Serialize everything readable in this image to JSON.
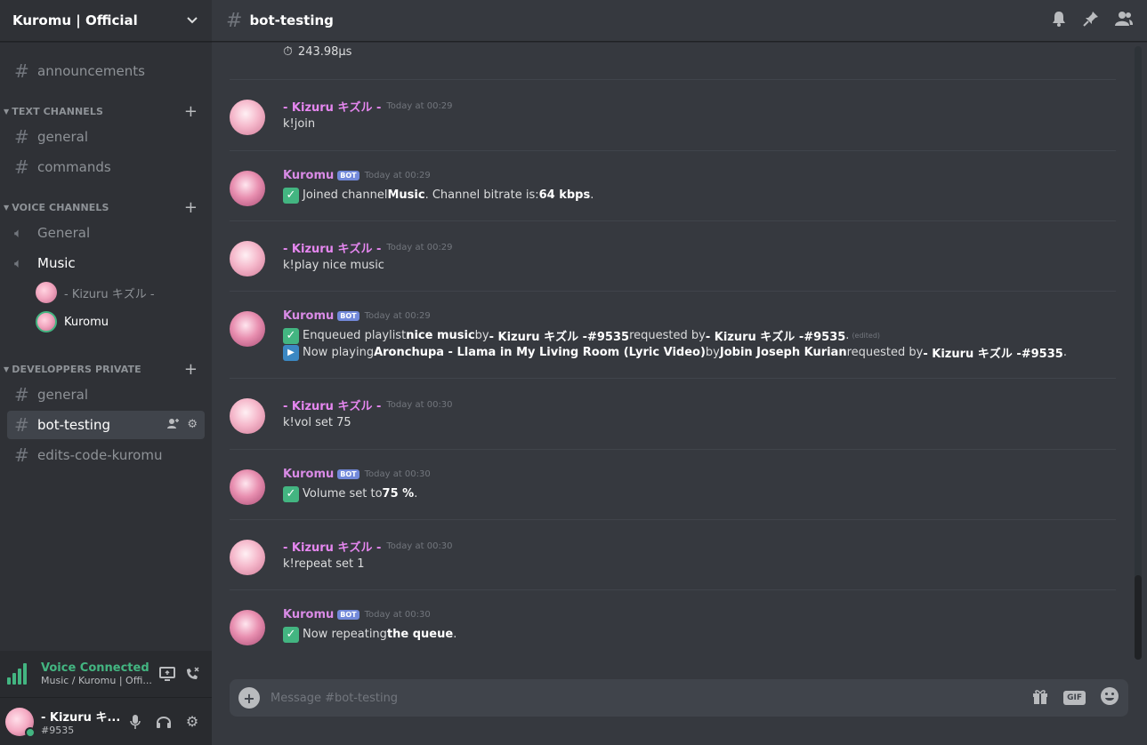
{
  "server": {
    "name": "Kuromu | Official"
  },
  "sidebar": {
    "top_channel": "announcements",
    "categories": [
      {
        "name": "TEXT CHANNELS"
      },
      {
        "name": "VOICE CHANNELS"
      },
      {
        "name": "DEVELOPPERS PRIVATE"
      }
    ],
    "text_channels": [
      "general",
      "commands"
    ],
    "voice_channels": [
      "General",
      "Music"
    ],
    "voice_users": [
      "- Kizuru キズル -",
      "Kuromu"
    ],
    "dev_channels": [
      "general",
      "bot-testing",
      "edits-code-kuromu"
    ]
  },
  "voice_panel": {
    "title": "Voice Connected",
    "subtitle": "Music / Kuromu | Offi..."
  },
  "user_panel": {
    "name": "- Kizuru キ...",
    "tag": "#9535"
  },
  "channel": {
    "name": "bot-testing"
  },
  "messages": {
    "first": "243.98µs",
    "m1": {
      "author": "- Kizuru キズル -",
      "time": "Today at 00:29",
      "text": "k!join"
    },
    "m2": {
      "author": "Kuromu",
      "badge": "BOT",
      "time": "Today at 00:29",
      "t1": "Joined channel ",
      "b1": "Music",
      "t2": ". Channel bitrate is: ",
      "b2": "64 kbps",
      "t3": "."
    },
    "m3": {
      "author": "- Kizuru キズル -",
      "time": "Today at 00:29",
      "text": "k!play nice music"
    },
    "m4": {
      "author": "Kuromu",
      "badge": "BOT",
      "time": "Today at 00:29",
      "a1": "Enqueued playlist ",
      "ab1": "nice music",
      "a2": " by ",
      "ab2": "- Kizuru キズル -#9535",
      "a3": " requested by ",
      "ab3": "- Kizuru キズル -#9535",
      "a4": ".",
      "edited": "(edited)",
      "p1": "Now playing ",
      "pb1": "Aronchupa - Llama in My Living Room (Lyric Video)",
      "p2": " by ",
      "pb2": "Jobin Joseph Kurian",
      "p3": " requested by ",
      "pb3": "- Kizuru キズル -#9535",
      "p4": "."
    },
    "m5": {
      "author": "- Kizuru キズル -",
      "time": "Today at 00:30",
      "text": "k!vol set 75"
    },
    "m6": {
      "author": "Kuromu",
      "badge": "BOT",
      "time": "Today at 00:30",
      "t1": "Volume set to ",
      "b1": "75 %",
      "t2": "."
    },
    "m7": {
      "author": "- Kizuru キズル -",
      "time": "Today at 00:30",
      "text": "k!repeat set 1"
    },
    "m8": {
      "author": "Kuromu",
      "badge": "BOT",
      "time": "Today at 00:30",
      "t1": "Now repeating ",
      "b1": "the queue",
      "t2": "."
    }
  },
  "composer": {
    "placeholder": "Message #bot-testing",
    "gif": "GIF"
  },
  "colors": {
    "accent": "#7289da",
    "online": "#43b581",
    "author": "#e687f0"
  }
}
